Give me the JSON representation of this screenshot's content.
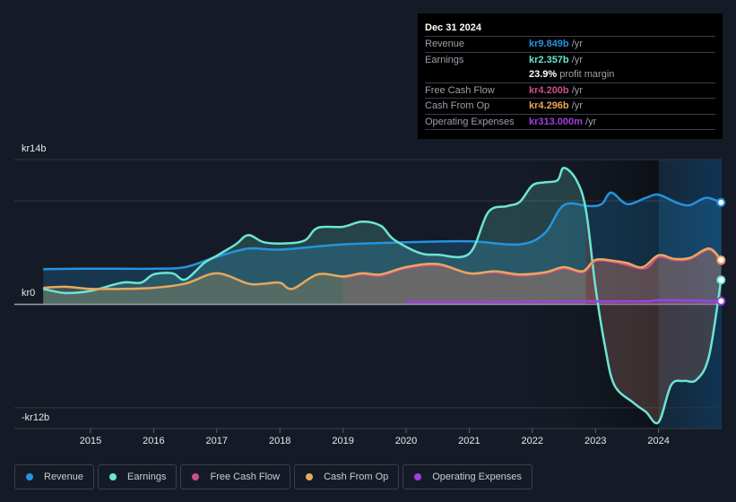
{
  "tooltip": {
    "date": "Dec 31 2024",
    "rows": [
      {
        "label": "Revenue",
        "value": "kr9.849b",
        "unit": " /yr",
        "color": "#2394df"
      },
      {
        "label": "Earnings",
        "value": "kr2.357b",
        "unit": " /yr",
        "color": "#6ce5d3"
      },
      {
        "label": "",
        "value": "23.9%",
        "unit": " profit margin",
        "color": "#ffffff"
      },
      {
        "label": "Free Cash Flow",
        "value": "kr4.200b",
        "unit": " /yr",
        "color": "#c94f8d"
      },
      {
        "label": "Cash From Op",
        "value": "kr4.296b",
        "unit": " /yr",
        "color": "#e8a85c"
      },
      {
        "label": "Operating Expenses",
        "value": "kr313.000m",
        "unit": " /yr",
        "color": "#a040e0"
      }
    ]
  },
  "legend": [
    {
      "label": "Revenue",
      "color": "#2394df"
    },
    {
      "label": "Earnings",
      "color": "#6ce5d3"
    },
    {
      "label": "Free Cash Flow",
      "color": "#c94f8d"
    },
    {
      "label": "Cash From Op",
      "color": "#e8a85c"
    },
    {
      "label": "Operating Expenses",
      "color": "#a040e0"
    }
  ],
  "chart_data": {
    "type": "area",
    "title": "",
    "xlabel": "",
    "ylabel": "",
    "currency": "kr",
    "unit": "billions",
    "ylim": [
      -12,
      14
    ],
    "xlim": [
      2014.25,
      2025.0
    ],
    "y_tick_labels": [
      {
        "value": 14,
        "label": "kr14b"
      },
      {
        "value": 0,
        "label": "kr0"
      },
      {
        "value": -12,
        "label": "-kr12b"
      }
    ],
    "gridlines_y": [
      14,
      10,
      0,
      -10
    ],
    "x_ticks": [
      2015,
      2016,
      2017,
      2018,
      2019,
      2020,
      2021,
      2022,
      2023,
      2024
    ],
    "highlight_from": 2024.0,
    "series": [
      {
        "name": "Revenue",
        "color": "#2394df",
        "x": [
          2014.25,
          2015.0,
          2016.0,
          2016.5,
          2017.0,
          2017.5,
          2018.0,
          2019.0,
          2020.0,
          2021.0,
          2021.8,
          2022.2,
          2022.5,
          2022.9,
          2023.1,
          2023.25,
          2023.5,
          2023.8,
          2024.0,
          2024.3,
          2024.5,
          2024.75,
          2024.99
        ],
        "values": [
          3.4,
          3.45,
          3.45,
          3.6,
          4.6,
          5.4,
          5.3,
          5.8,
          6.0,
          6.1,
          5.8,
          6.9,
          9.6,
          9.5,
          9.7,
          10.8,
          9.7,
          10.3,
          10.6,
          9.8,
          9.6,
          10.3,
          9.849
        ]
      },
      {
        "name": "Earnings",
        "color": "#6ce5d3",
        "x": [
          2014.25,
          2014.6,
          2015.0,
          2015.5,
          2015.8,
          2016.0,
          2016.3,
          2016.5,
          2016.8,
          2017.0,
          2017.3,
          2017.5,
          2017.75,
          2018.1,
          2018.4,
          2018.6,
          2019.0,
          2019.3,
          2019.6,
          2019.8,
          2020.2,
          2020.5,
          2021.0,
          2021.3,
          2021.6,
          2021.8,
          2022.0,
          2022.2,
          2022.4,
          2022.5,
          2022.7,
          2022.85,
          2023.0,
          2023.15,
          2023.3,
          2023.6,
          2023.8,
          2024.0,
          2024.2,
          2024.4,
          2024.6,
          2024.8,
          2024.99
        ],
        "values": [
          1.5,
          1.1,
          1.3,
          2.1,
          2.1,
          2.9,
          3.0,
          2.4,
          4.0,
          4.7,
          5.8,
          6.7,
          6.0,
          5.9,
          6.2,
          7.4,
          7.5,
          8.0,
          7.6,
          6.3,
          5.0,
          4.8,
          4.9,
          8.9,
          9.5,
          9.9,
          11.5,
          11.8,
          12.0,
          13.2,
          12.0,
          9.1,
          1.7,
          -4.0,
          -7.8,
          -9.5,
          -10.4,
          -11.4,
          -7.8,
          -7.4,
          -7.3,
          -5.0,
          2.357
        ]
      },
      {
        "name": "Free Cash Flow",
        "color": "#c94f8d",
        "x": [
          2019.0,
          2019.3,
          2019.6,
          2020.0,
          2020.5,
          2021.0,
          2021.4,
          2021.8,
          2022.2,
          2022.5,
          2022.8,
          2023.0,
          2023.3,
          2023.5,
          2023.8,
          2024.0,
          2024.25,
          2024.5,
          2024.8,
          2024.99
        ],
        "values": [
          2.6,
          2.9,
          2.8,
          3.5,
          3.8,
          3.0,
          3.1,
          2.8,
          3.0,
          3.5,
          3.1,
          4.2,
          4.1,
          3.8,
          3.5,
          4.6,
          4.3,
          4.4,
          5.3,
          4.2
        ]
      },
      {
        "name": "Cash From Op",
        "color": "#e8a85c",
        "x": [
          2014.25,
          2014.6,
          2015.0,
          2015.5,
          2016.0,
          2016.5,
          2017.0,
          2017.5,
          2017.75,
          2018.0,
          2018.2,
          2018.6,
          2019.0,
          2019.3,
          2019.6,
          2020.0,
          2020.5,
          2021.0,
          2021.4,
          2021.8,
          2022.2,
          2022.5,
          2022.8,
          2023.0,
          2023.3,
          2023.5,
          2023.75,
          2024.0,
          2024.25,
          2024.5,
          2024.8,
          2024.99
        ],
        "values": [
          1.6,
          1.7,
          1.5,
          1.5,
          1.6,
          2.0,
          3.0,
          2.0,
          2.0,
          2.1,
          1.5,
          2.9,
          2.7,
          3.0,
          2.9,
          3.6,
          3.9,
          3.0,
          3.2,
          2.9,
          3.1,
          3.6,
          3.2,
          4.3,
          4.2,
          4.0,
          3.6,
          4.75,
          4.4,
          4.5,
          5.4,
          4.296
        ]
      },
      {
        "name": "Operating Expenses",
        "color": "#a040e0",
        "x": [
          2020.0,
          2021.0,
          2022.0,
          2023.0,
          2023.8,
          2024.0,
          2024.5,
          2024.99
        ],
        "values": [
          0.25,
          0.25,
          0.26,
          0.3,
          0.3,
          0.4,
          0.38,
          0.313
        ]
      }
    ]
  }
}
